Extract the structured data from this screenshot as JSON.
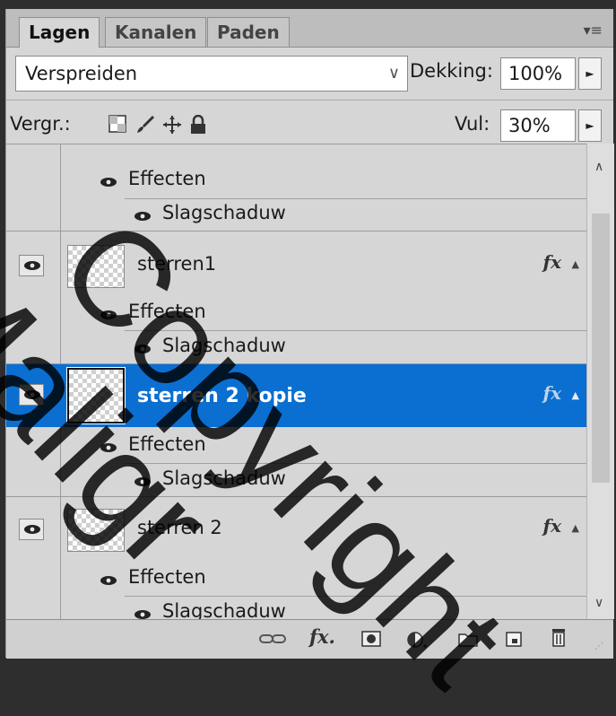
{
  "tabs": [
    {
      "label": "Lagen",
      "active": true
    },
    {
      "label": "Kanalen",
      "active": false
    },
    {
      "label": "Paden",
      "active": false
    }
  ],
  "blend_mode": "Verspreiden",
  "opacity": {
    "label": "Dekking:",
    "value": "100%"
  },
  "lock": {
    "label": "Vergr.:",
    "icons": [
      "transparency-lock-icon",
      "brush-icon",
      "move-icon",
      "padlock-icon"
    ]
  },
  "fill": {
    "label": "Vul:",
    "value": "30%"
  },
  "layers": [
    {
      "effects_label": "Effecten",
      "effect": "Slagschaduw"
    },
    {
      "name": "sterren1",
      "fx": "fx",
      "selected": false,
      "effects_label": "Effecten",
      "effect": "Slagschaduw"
    },
    {
      "name": "sterren 2 kopie",
      "fx": "fx",
      "selected": true,
      "effects_label": "Effecten",
      "effect": "Slagschaduw"
    },
    {
      "name": "sterren 2",
      "fx": "fx",
      "selected": false,
      "effects_label": "Effecten",
      "effect": "Slagschaduw"
    }
  ],
  "bottom_icons": [
    "link-icon",
    "fx-icon",
    "mask-icon",
    "adjustment-icon",
    "folder-icon",
    "new-layer-icon",
    "trash-icon"
  ],
  "watermark": {
    "line1": "Copyright",
    "line2": "Maligr"
  },
  "colors": {
    "selection": "#0a6fd1",
    "panel": "#d6d6d6"
  }
}
